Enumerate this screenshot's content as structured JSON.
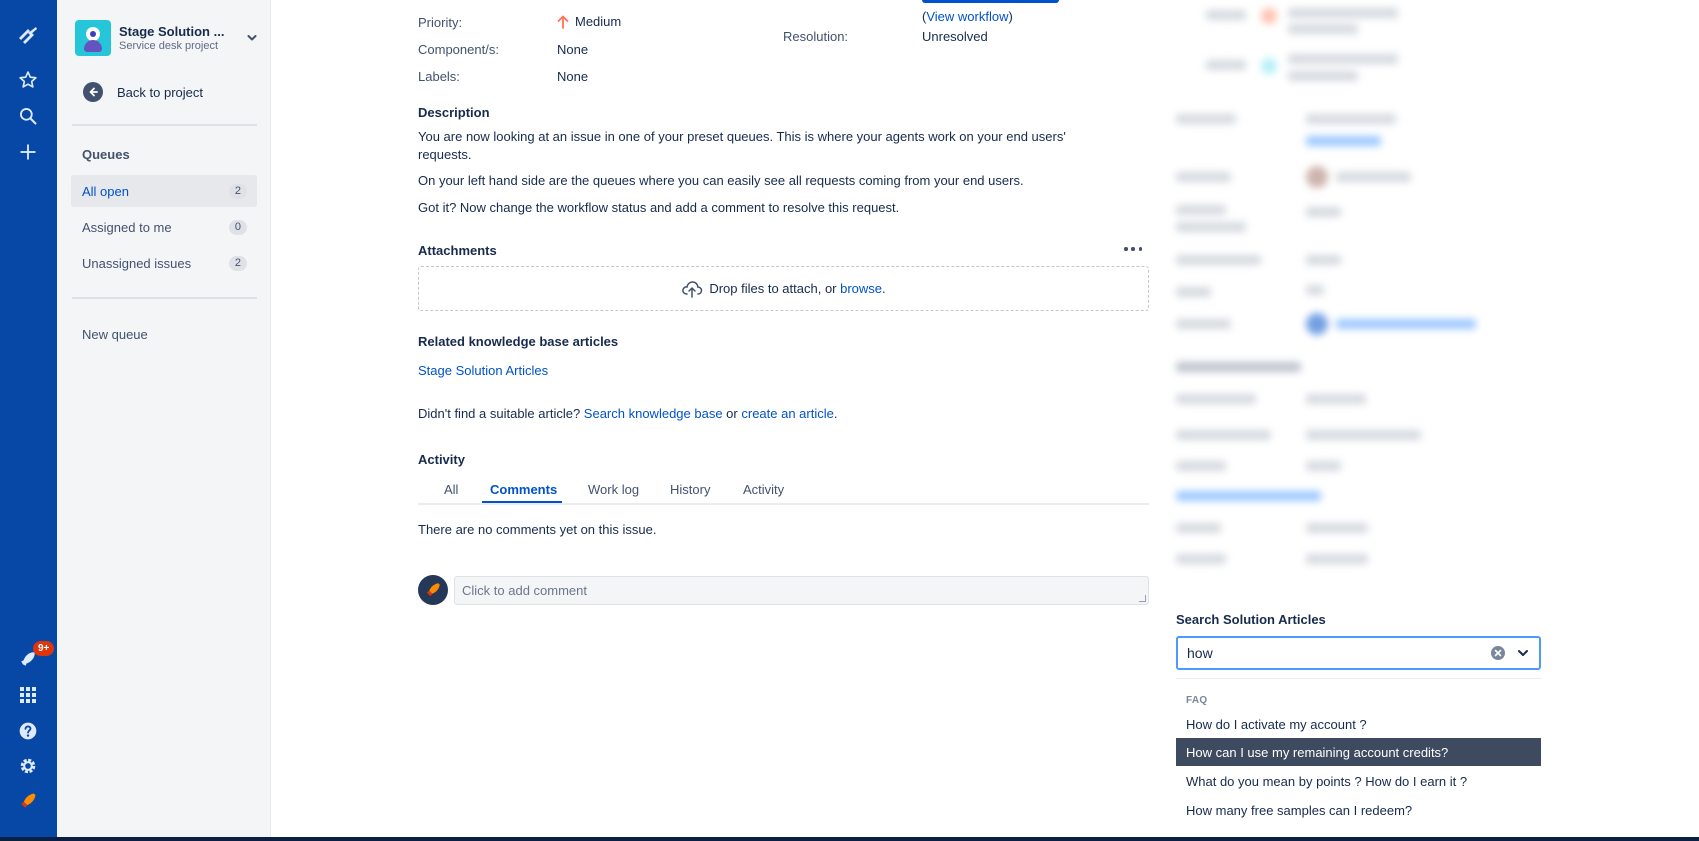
{
  "colors": {
    "nav_bg": "#0747a6",
    "accent": "#0052cc",
    "highlight_option_bg": "#3d4a5f",
    "badge_red": "#de350b"
  },
  "global_nav": {
    "icons": [
      "jira-logo-icon",
      "star-icon",
      "search-icon",
      "plus-icon",
      "notification-rocket-icon",
      "app-switcher-icon",
      "help-icon",
      "settings-icon",
      "user-avatar-icon"
    ],
    "notification_badge": "9+"
  },
  "sidebar": {
    "project_name": "Stage Solution ...",
    "project_type": "Service desk project",
    "back_label": "Back to project",
    "queues_heading": "Queues",
    "queues": [
      {
        "label": "All open",
        "count": "2",
        "active": true
      },
      {
        "label": "Assigned to me",
        "count": "0",
        "active": false
      },
      {
        "label": "Unassigned issues",
        "count": "2",
        "active": false
      }
    ],
    "new_queue": "New queue"
  },
  "details": {
    "priority_label": "Priority:",
    "priority_value": "Medium",
    "component_label": "Component/s:",
    "component_value": "None",
    "labels_label": "Labels:",
    "labels_value": "None",
    "view_workflow_open": "(",
    "view_workflow_link": "View workflow",
    "view_workflow_close": ")",
    "resolution_label": "Resolution:",
    "resolution_value": "Unresolved"
  },
  "description": {
    "heading": "Description",
    "p1": "You are now looking at an issue in one of your preset queues. This is where your agents work on your end users' requests.",
    "p2": "On your left hand side are the queues where you can easily see all requests coming from your end users.",
    "p3": "Got it? Now change the workflow status and add a comment to resolve this request."
  },
  "attachments": {
    "heading": "Attachments",
    "drop_text": "Drop files to attach, or ",
    "browse_link": "browse",
    "drop_suffix": "."
  },
  "kb": {
    "heading": "Related knowledge base articles",
    "articles_link": "Stage Solution Articles",
    "prompt": "Didn't find a suitable article? ",
    "search_link": "Search knowledge base",
    "or": " or ",
    "create_link": "create an article",
    "suffix": "."
  },
  "activity": {
    "heading": "Activity",
    "tabs": [
      "All",
      "Comments",
      "Work log",
      "History",
      "Activity"
    ],
    "active_tab": "Comments",
    "empty_text": "There are no comments yet on this issue.",
    "comment_placeholder": "Click to add comment"
  },
  "solution_search": {
    "label": "Search Solution Articles",
    "query": "how",
    "group_heading": "FAQ",
    "options": [
      "How do I activate my account ?",
      "How can I use my remaining account credits?",
      "What do you mean by points ? How do I earn it ?",
      "How many free samples can I redeem?"
    ],
    "highlighted_option": "How can I use my remaining account credits?"
  }
}
